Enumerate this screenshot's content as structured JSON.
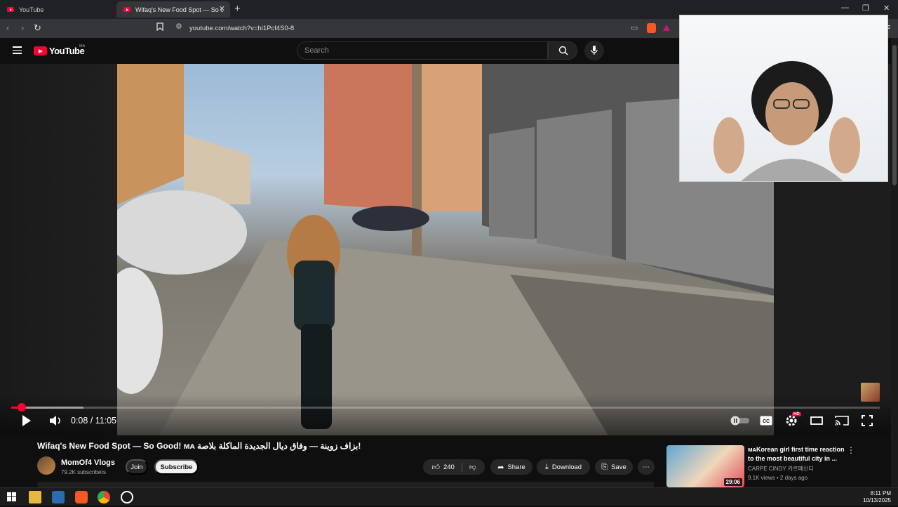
{
  "browser": {
    "tabs": [
      {
        "label": "YouTube",
        "active": false
      },
      {
        "label": "Wifaq's New Food Spot — So Good!",
        "active": true
      }
    ],
    "new_tab_symbol": "+",
    "url": "youtube.com/watch?v=hi1Pcf4S0-8"
  },
  "youtube": {
    "logo_text": "YouTube",
    "country_code": "MA",
    "search_placeholder": "Search"
  },
  "player": {
    "current_time": "0:08",
    "duration": "11:05",
    "time_display": "0:08 / 11:05",
    "progress_fraction": 0.012,
    "buffered_fraction": 0.083,
    "quality_badge": "HD",
    "accent_color": "#ff0033"
  },
  "video_info": {
    "title": "Wifaq's New Food Spot — So Good! ᴍᴀ بزاف زوينة — وفاق ديال الجديدة الماكلة بلاصة!",
    "channel_name": "MomOf4 Vlogs",
    "subscribers": "79.2K subscribers",
    "join_label": "Join",
    "subscribe_label": "Subscribe",
    "like_count": "240",
    "share_label": "Share",
    "download_label": "Download",
    "save_label": "Save"
  },
  "recommendation": {
    "title": "ᴍᴀKorean girl first time reaction to the most beautiful city in ...",
    "channel": "CARPE CINDY 카르페신디",
    "meta": "9.1K views • 2 days ago",
    "duration": "29:06"
  },
  "taskbar": {
    "time": "8:11 PM",
    "date": "10/13/2025"
  }
}
